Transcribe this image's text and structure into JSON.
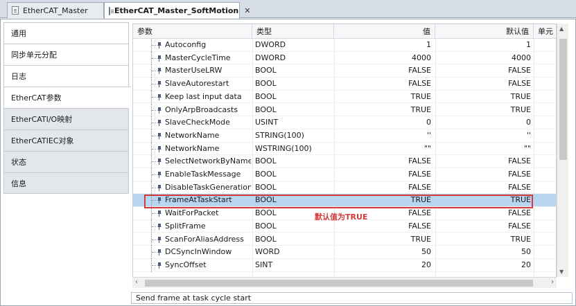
{
  "tabs": [
    {
      "label": "EtherCAT_Master",
      "active": false
    },
    {
      "label": "EtherCAT_Master_SoftMotion",
      "active": true
    }
  ],
  "nav": {
    "items": [
      {
        "label": "通用"
      },
      {
        "label": "同步单元分配"
      },
      {
        "label": "日志"
      },
      {
        "label": "EtherCAT参数"
      },
      {
        "label": "EtherCATI/O映射"
      },
      {
        "label": "EtherCATIEC对象"
      },
      {
        "label": "状态"
      },
      {
        "label": "信息"
      }
    ],
    "selected_index": 3
  },
  "grid": {
    "headers": {
      "param": "参数",
      "type": "类型",
      "value": "值",
      "default": "默认值",
      "unit": "单元"
    },
    "rows": [
      {
        "name": "Autoconfig",
        "type": "DWORD",
        "value": "1",
        "default": "1"
      },
      {
        "name": "MasterCycleTime",
        "type": "DWORD",
        "value": "4000",
        "default": "4000"
      },
      {
        "name": "MasterUseLRW",
        "type": "BOOL",
        "value": "FALSE",
        "default": "FALSE"
      },
      {
        "name": "SlaveAutorestart",
        "type": "BOOL",
        "value": "FALSE",
        "default": "FALSE"
      },
      {
        "name": "Keep last input data",
        "type": "BOOL",
        "value": "TRUE",
        "default": "TRUE"
      },
      {
        "name": "OnlyArpBroadcasts",
        "type": "BOOL",
        "value": "TRUE",
        "default": "TRUE"
      },
      {
        "name": "SlaveCheckMode",
        "type": "USINT",
        "value": "0",
        "default": "0"
      },
      {
        "name": "NetworkName",
        "type": "STRING(100)",
        "value": "''",
        "default": "''"
      },
      {
        "name": "NetworkName",
        "type": "WSTRING(100)",
        "value": "\"\"",
        "default": "\"\""
      },
      {
        "name": "SelectNetworkByName",
        "type": "BOOL",
        "value": "FALSE",
        "default": "FALSE"
      },
      {
        "name": "EnableTaskMessage",
        "type": "BOOL",
        "value": "FALSE",
        "default": "FALSE"
      },
      {
        "name": "DisableTaskGeneration",
        "type": "BOOL",
        "value": "FALSE",
        "default": "FALSE"
      },
      {
        "name": "FrameAtTaskStart",
        "type": "BOOL",
        "value": "TRUE",
        "default": "TRUE"
      },
      {
        "name": "WaitForPacket",
        "type": "BOOL",
        "value": "FALSE",
        "default": "FALSE"
      },
      {
        "name": "SplitFrame",
        "type": "BOOL",
        "value": "FALSE",
        "default": "FALSE"
      },
      {
        "name": "ScanForAliasAddress",
        "type": "BOOL",
        "value": "TRUE",
        "default": "TRUE"
      },
      {
        "name": "DCSyncInWindow",
        "type": "WORD",
        "value": "50",
        "default": "50"
      },
      {
        "name": "SyncOffset",
        "type": "SINT",
        "value": "20",
        "default": "20"
      }
    ],
    "highlighted_index": 12
  },
  "annotation": "默认值为TRUE",
  "status": "Send frame at task cycle start",
  "colors": {
    "highlight_row": "#b8d5f2",
    "annotation_red": "#d43a3a"
  }
}
